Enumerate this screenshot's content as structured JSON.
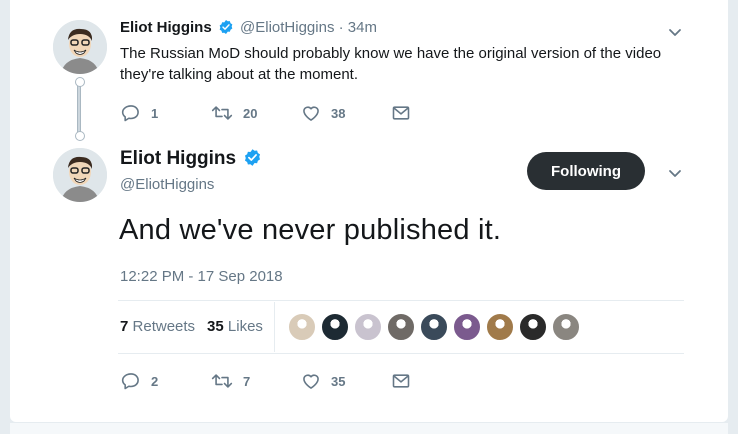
{
  "reply_tweet": {
    "name": "Eliot Higgins",
    "handle": "@EliotHiggins",
    "dot": "·",
    "time": "34m",
    "text": "The Russian MoD should probably know we have the original version of the video they're talking about at the moment.",
    "counts": {
      "replies": "1",
      "retweets": "20",
      "likes": "38"
    }
  },
  "main_tweet": {
    "name": "Eliot Higgins",
    "handle": "@EliotHiggins",
    "follow_label": "Following",
    "text": "And we've never published it.",
    "timestamp": "12:22 PM - 17 Sep 2018",
    "stats": {
      "retweets_count": "7",
      "retweets_label": "Retweets",
      "likes_count": "35",
      "likes_label": "Likes"
    },
    "counts": {
      "replies": "2",
      "retweets": "7",
      "likes": "35"
    }
  },
  "liker_colors": [
    "#d9cbb8",
    "#1d2a33",
    "#c9c3cf",
    "#6f6a66",
    "#3a4a5a",
    "#7b5a8e",
    "#a07a4a",
    "#2a2a2a",
    "#8a8680"
  ],
  "colors": {
    "accent_verified": "#1da1f2",
    "follow_button_bg": "#292f33",
    "muted_text": "#657786"
  },
  "icons": [
    "verified-badge-icon",
    "chevron-down-icon",
    "reply-icon",
    "retweet-icon",
    "like-icon",
    "dm-icon"
  ]
}
